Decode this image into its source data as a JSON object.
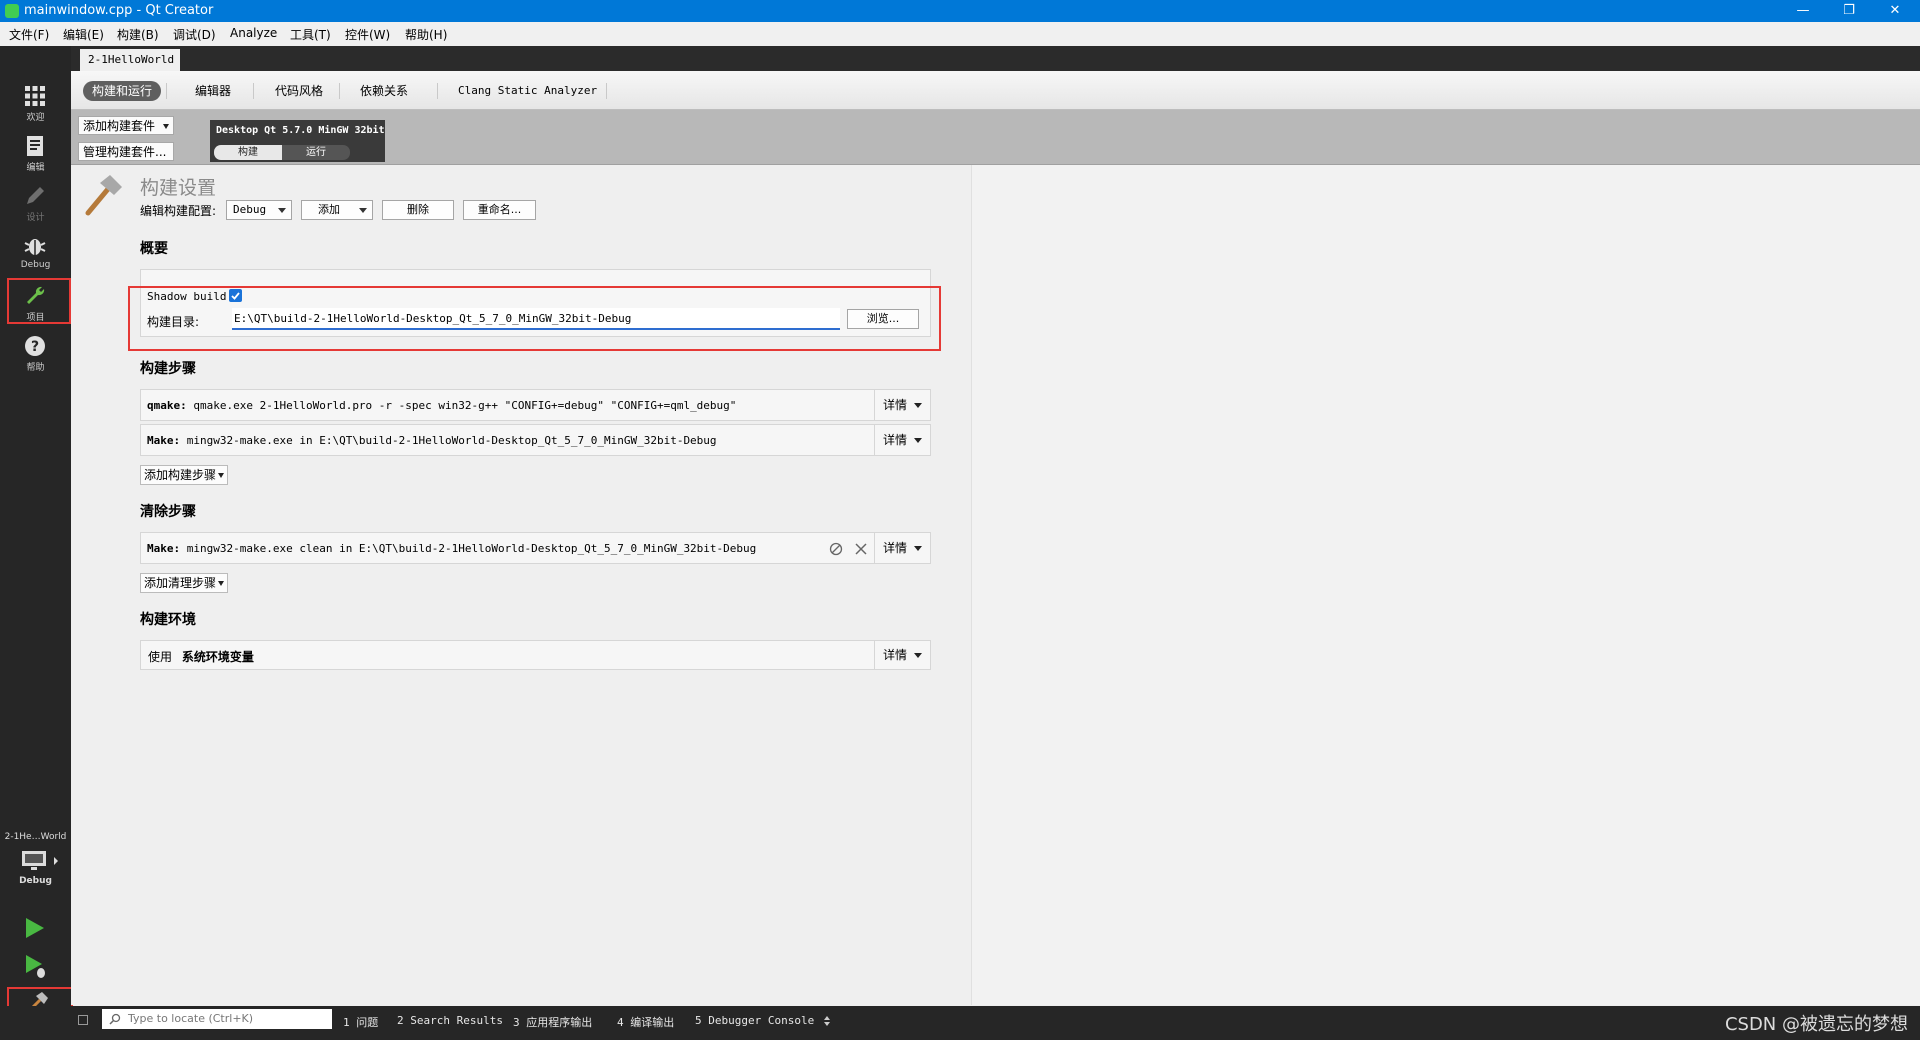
{
  "window": {
    "title": "mainwindow.cpp - Qt Creator",
    "controls": [
      "—",
      "❐",
      "✕"
    ]
  },
  "menu": [
    "文件(F)",
    "编辑(E)",
    "构建(B)",
    "调试(D)",
    "Analyze",
    "工具(T)",
    "控件(W)",
    "帮助(H)"
  ],
  "modes": [
    {
      "label": "欢迎",
      "icon": "grid-icon"
    },
    {
      "label": "编辑",
      "icon": "document-icon"
    },
    {
      "label": "设计",
      "icon": "pencil-icon"
    },
    {
      "label": "Debug",
      "icon": "bug-icon"
    },
    {
      "label": "项目",
      "icon": "wrench-icon"
    },
    {
      "label": "帮助",
      "icon": "help-icon"
    }
  ],
  "target": {
    "project": "2-1He…World",
    "config": "Debug"
  },
  "project_tab": "2-1HelloWorld",
  "settings_tabs": [
    "构建和运行",
    "编辑器",
    "代码风格",
    "依赖关系",
    "Clang Static Analyzer"
  ],
  "kitbar": {
    "add_kit": "添加构建套件",
    "manage_kits": "管理构建套件...",
    "kit_name": "Desktop Qt 5.7.0 MinGW 32bit",
    "build": "构建",
    "run": "运行"
  },
  "build_settings": {
    "title": "构建设置",
    "edit_config_label": "编辑构建配置:",
    "config_value": "Debug",
    "add": "添加",
    "delete": "删除",
    "rename": "重命名..."
  },
  "overview": {
    "heading": "概要",
    "shadow_label": "Shadow build:",
    "shadow_checked": true,
    "dir_label": "构建目录:",
    "dir_value": "E:\\QT\\build-2-1HelloWorld-Desktop_Qt_5_7_0_MinGW_32bit-Debug",
    "browse": "浏览..."
  },
  "build_steps": {
    "heading": "构建步骤",
    "steps": [
      {
        "name": "qmake:",
        "cmd": " qmake.exe 2-1HelloWorld.pro -r -spec win32-g++ \"CONFIG+=debug\" \"CONFIG+=qml_debug\""
      },
      {
        "name": "Make:",
        "cmd": " mingw32-make.exe in E:\\QT\\build-2-1HelloWorld-Desktop_Qt_5_7_0_MinGW_32bit-Debug"
      }
    ],
    "add_step": "添加构建步骤"
  },
  "clean_steps": {
    "heading": "清除步骤",
    "steps": [
      {
        "name": "Make:",
        "cmd": " mingw32-make.exe clean in E:\\QT\\build-2-1HelloWorld-Desktop_Qt_5_7_0_MinGW_32bit-Debug"
      }
    ],
    "add_step": "添加清理步骤"
  },
  "environment": {
    "heading": "构建环境",
    "use": "使用",
    "value": "系统环境变量"
  },
  "details": "详情",
  "statusbar": {
    "locator_placeholder": "Type to locate (Ctrl+K)",
    "panes": [
      "1 问题",
      "2 Search Results",
      "3 应用程序输出",
      "4 编译输出",
      "5 Debugger Console"
    ],
    "watermark": "CSDN @被遗忘的梦想"
  },
  "colors": {
    "titlebar": "#0078d7",
    "modebar": "#262626",
    "highlight": "#e53935",
    "run": "#49b842"
  }
}
